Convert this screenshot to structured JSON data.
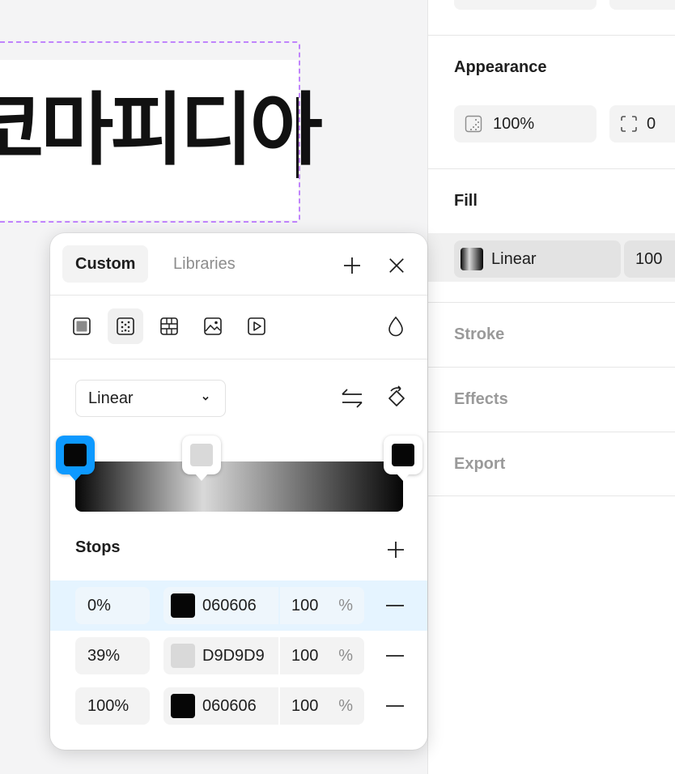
{
  "canvas": {
    "text": "코마피디아"
  },
  "panel": {
    "appearance": {
      "title": "Appearance",
      "opacity_value": "100%",
      "corner_radius_value": "0"
    },
    "fill": {
      "title": "Fill",
      "type": "Linear",
      "opacity": "100"
    },
    "stroke_title": "Stroke",
    "effects_title": "Effects",
    "export_title": "Export"
  },
  "popover": {
    "tabs": [
      {
        "label": "Custom",
        "active": true
      },
      {
        "label": "Libraries",
        "active": false
      }
    ],
    "paint_types": [
      "solid-paint-icon",
      "gradient-paint-icon",
      "pattern-paint-icon",
      "image-paint-icon",
      "video-paint-icon"
    ],
    "gradient_type": "Linear",
    "stops_title": "Stops",
    "stops": [
      {
        "position": "0%",
        "hex": "060606",
        "color": "#060606",
        "opacity": "100",
        "unit": "%",
        "selected": true
      },
      {
        "position": "39%",
        "hex": "D9D9D9",
        "color": "#D9D9D9",
        "opacity": "100",
        "unit": "%",
        "selected": false
      },
      {
        "position": "100%",
        "hex": "060606",
        "color": "#060606",
        "opacity": "100",
        "unit": "%",
        "selected": false
      }
    ]
  },
  "colors": {
    "selection_blue": "#0d99ff",
    "selection_dashed": "#c084fc",
    "selected_row": "#e5f4ff"
  }
}
